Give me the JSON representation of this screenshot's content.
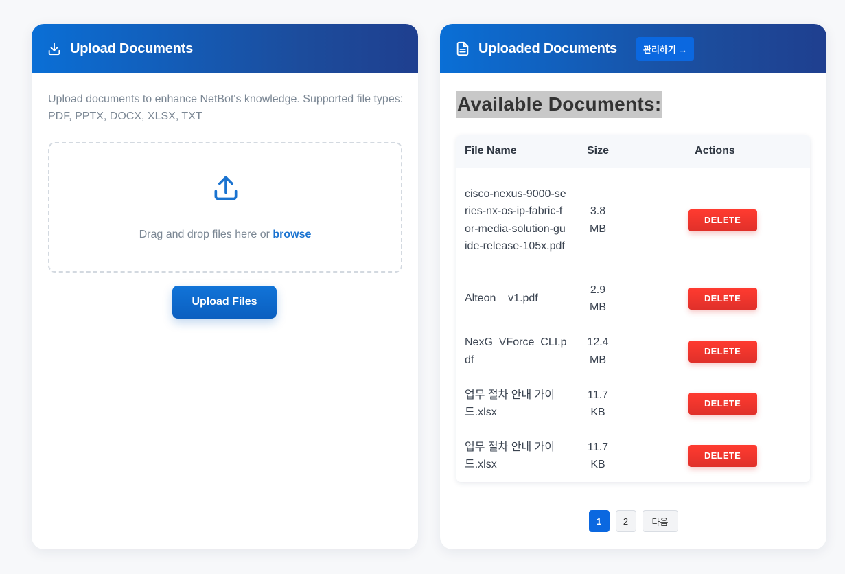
{
  "upload_card": {
    "title": "Upload Documents",
    "description": "Upload documents to enhance NetBot's knowledge. Supported file types: PDF, PPTX, DOCX, XLSX, TXT",
    "dropzone_text": "Drag and drop files here or ",
    "browse_label": "browse",
    "upload_button_label": "Upload Files"
  },
  "uploaded_card": {
    "title": "Uploaded Documents",
    "manage_button_label": "관리하기 →",
    "section_title": "Available Documents:",
    "table": {
      "columns": [
        "File Name",
        "Size",
        "Actions"
      ],
      "rows": [
        {
          "name": "cisco-nexus-9000-series-nx-os-ip-fabric-for-media-solution-guide-release-105x.pdf",
          "size": "3.8 MB",
          "action": "DELETE"
        },
        {
          "name": "Alteon__v1.pdf",
          "size": "2.9 MB",
          "action": "DELETE"
        },
        {
          "name": "NexG_VForce_CLI.pdf",
          "size": "12.4 MB",
          "action": "DELETE"
        },
        {
          "name": "업무 절차 안내 가이드.xlsx",
          "size": "11.7 KB",
          "action": "DELETE"
        },
        {
          "name": "업무 절차 안내 가이드.xlsx",
          "size": "11.7 KB",
          "action": "DELETE"
        }
      ]
    },
    "pagination": {
      "pages": [
        "1",
        "2"
      ],
      "current": "1",
      "next_label": "다음"
    }
  },
  "colors": {
    "header_gradient_start": "#0a6fd6",
    "header_gradient_end": "#1f3f8f",
    "accent": "#0b68e0",
    "delete": "#ff3b30",
    "browse_link": "#1a73d0"
  },
  "icons": {
    "upload_header": "download-tray-icon",
    "uploaded_header": "document-icon",
    "dropzone": "upload-tray-icon"
  }
}
